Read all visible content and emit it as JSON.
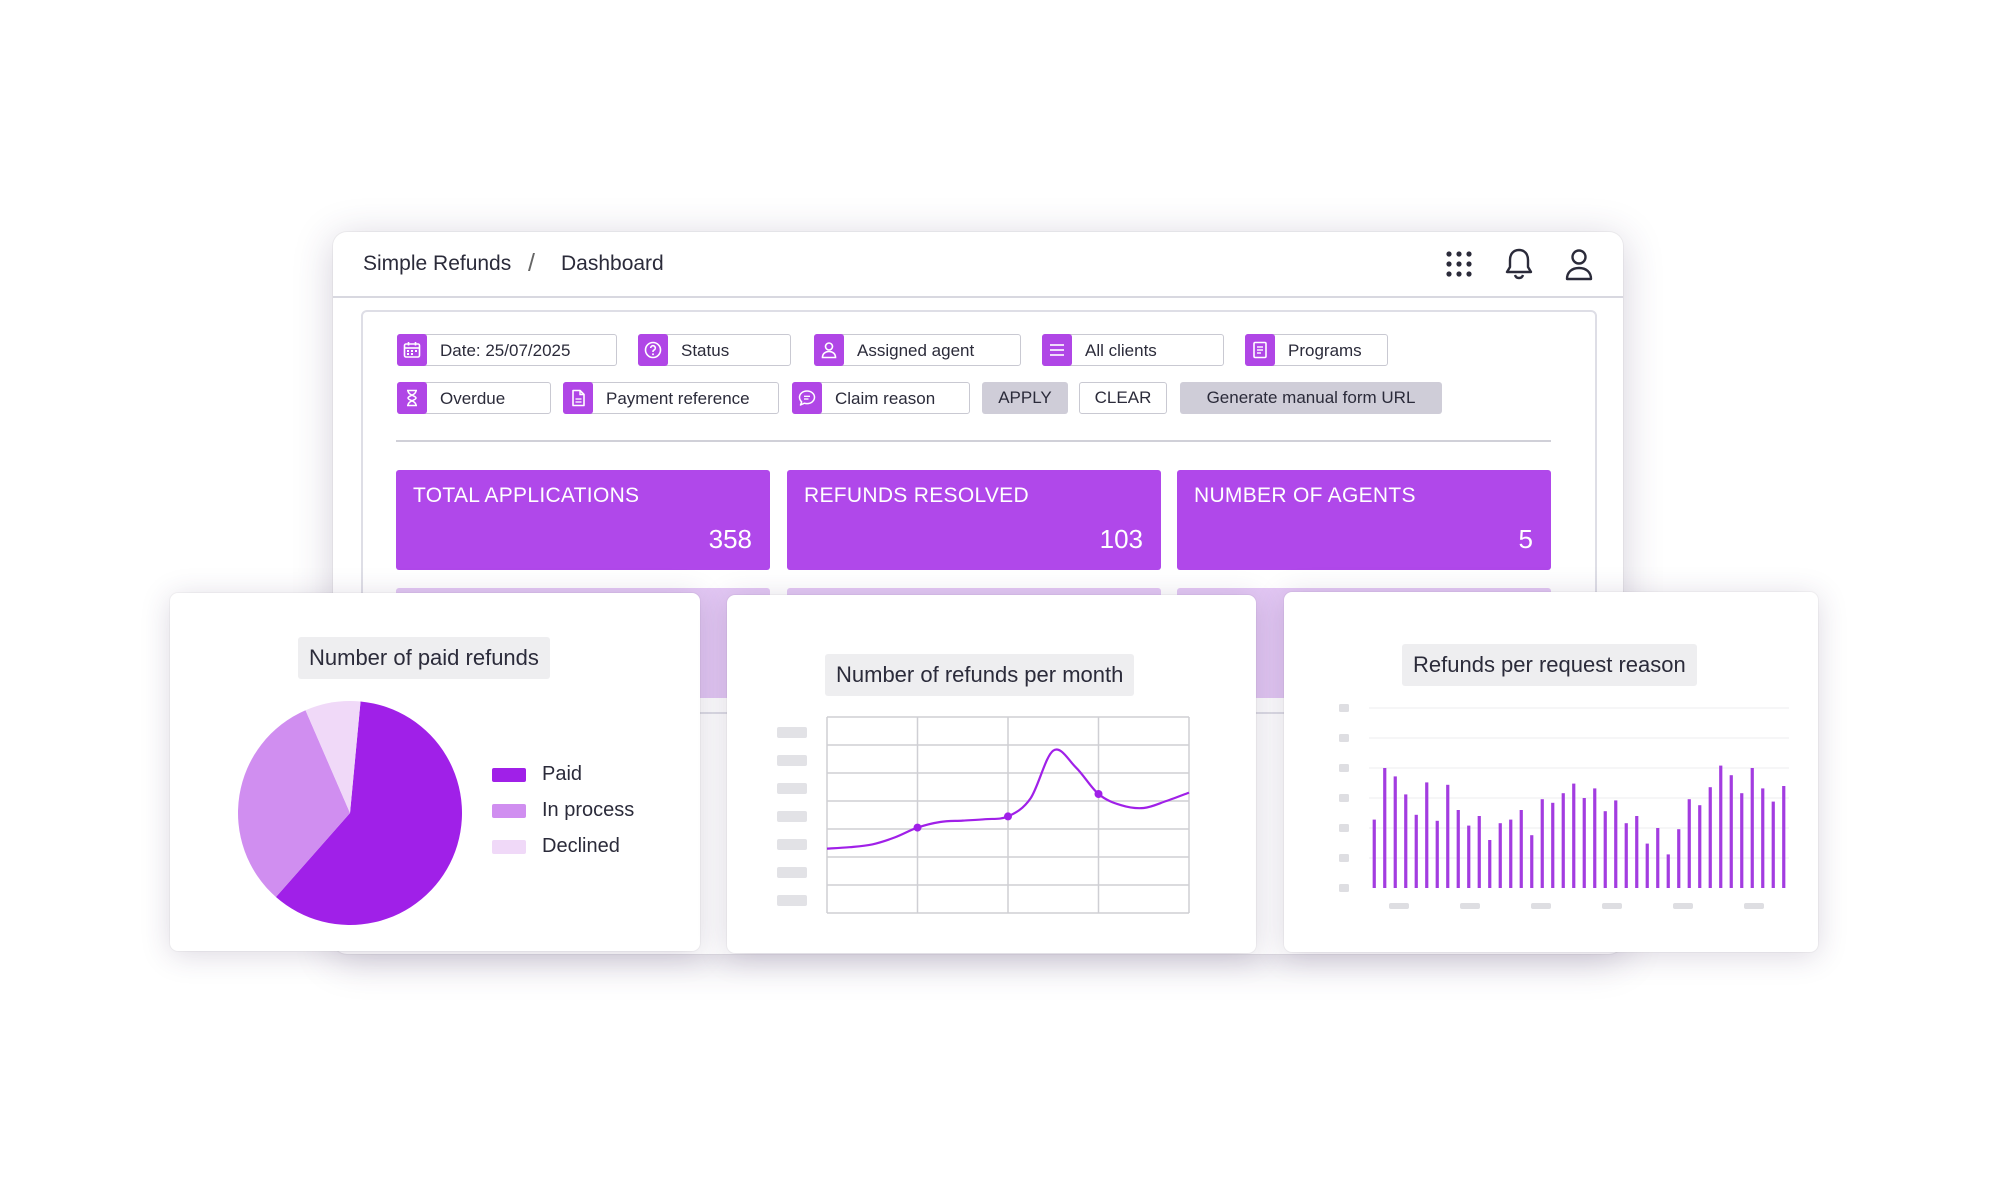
{
  "breadcrumb": {
    "app": "Simple Refunds",
    "separator": "/",
    "page": "Dashboard"
  },
  "topbar_icons": [
    "apps-grid-icon",
    "bell-icon",
    "user-icon"
  ],
  "filters": {
    "date": "Date: 25/07/2025",
    "status": "Status",
    "assigned_agent": "Assigned agent",
    "all_clients": "All clients",
    "programs": "Programs",
    "overdue": "Overdue",
    "payment_reference": "Payment reference",
    "claim_reason": "Claim reason"
  },
  "actions": {
    "apply": "APPLY",
    "clear": "CLEAR",
    "generate": "Generate manual form URL"
  },
  "stats": [
    {
      "label": "TOTAL APPLICATIONS",
      "value": "358"
    },
    {
      "label": "REFUNDS RESOLVED",
      "value": "103"
    },
    {
      "label": "NUMBER OF AGENTS",
      "value": "5"
    }
  ],
  "colors": {
    "accent": "#b048ea",
    "paid": "#a020e8",
    "in_process": "#d08ef0",
    "declined": "#f0d9f8",
    "stat_ghost": "#e3c8f4"
  },
  "chart_data": [
    {
      "type": "pie",
      "title": "Number of paid refunds",
      "slices": [
        {
          "label": "Paid",
          "value": 60,
          "color": "#a020e8"
        },
        {
          "label": "In process",
          "value": 32,
          "color": "#d08ef0"
        },
        {
          "label": "Declined",
          "value": 8,
          "color": "#f0d9f8"
        }
      ],
      "legend": "right"
    },
    {
      "type": "line",
      "title": "Number of refunds per month",
      "x": [
        0,
        0.25,
        0.5,
        0.75,
        1.0,
        1.25,
        1.5,
        1.75,
        2.0,
        2.25,
        2.5,
        2.75,
        3.0,
        3.25,
        3.5,
        3.75,
        4.0
      ],
      "y": [
        2.3,
        2.35,
        2.45,
        2.7,
        3.05,
        3.25,
        3.3,
        3.35,
        3.45,
        4.1,
        5.8,
        5.2,
        4.25,
        3.85,
        3.75,
        4.0,
        4.3
      ],
      "markers_at_x": [
        1,
        2,
        3
      ],
      "ylim": [
        0,
        7
      ],
      "xlim": [
        0,
        4
      ],
      "grid": true,
      "tick_labels_visible": false
    },
    {
      "type": "bar",
      "title": "Refunds per request reason",
      "values": [
        57,
        100,
        93,
        78,
        61,
        88,
        56,
        86,
        65,
        52,
        60,
        40,
        54,
        57,
        65,
        44,
        74,
        71,
        79,
        87,
        75,
        83,
        64,
        73,
        54,
        60,
        37,
        50,
        28,
        49,
        74,
        69,
        84,
        102,
        94,
        79,
        100,
        83,
        72,
        85
      ],
      "ylim": [
        0,
        150
      ],
      "grid": true,
      "tick_labels_visible": false
    }
  ]
}
